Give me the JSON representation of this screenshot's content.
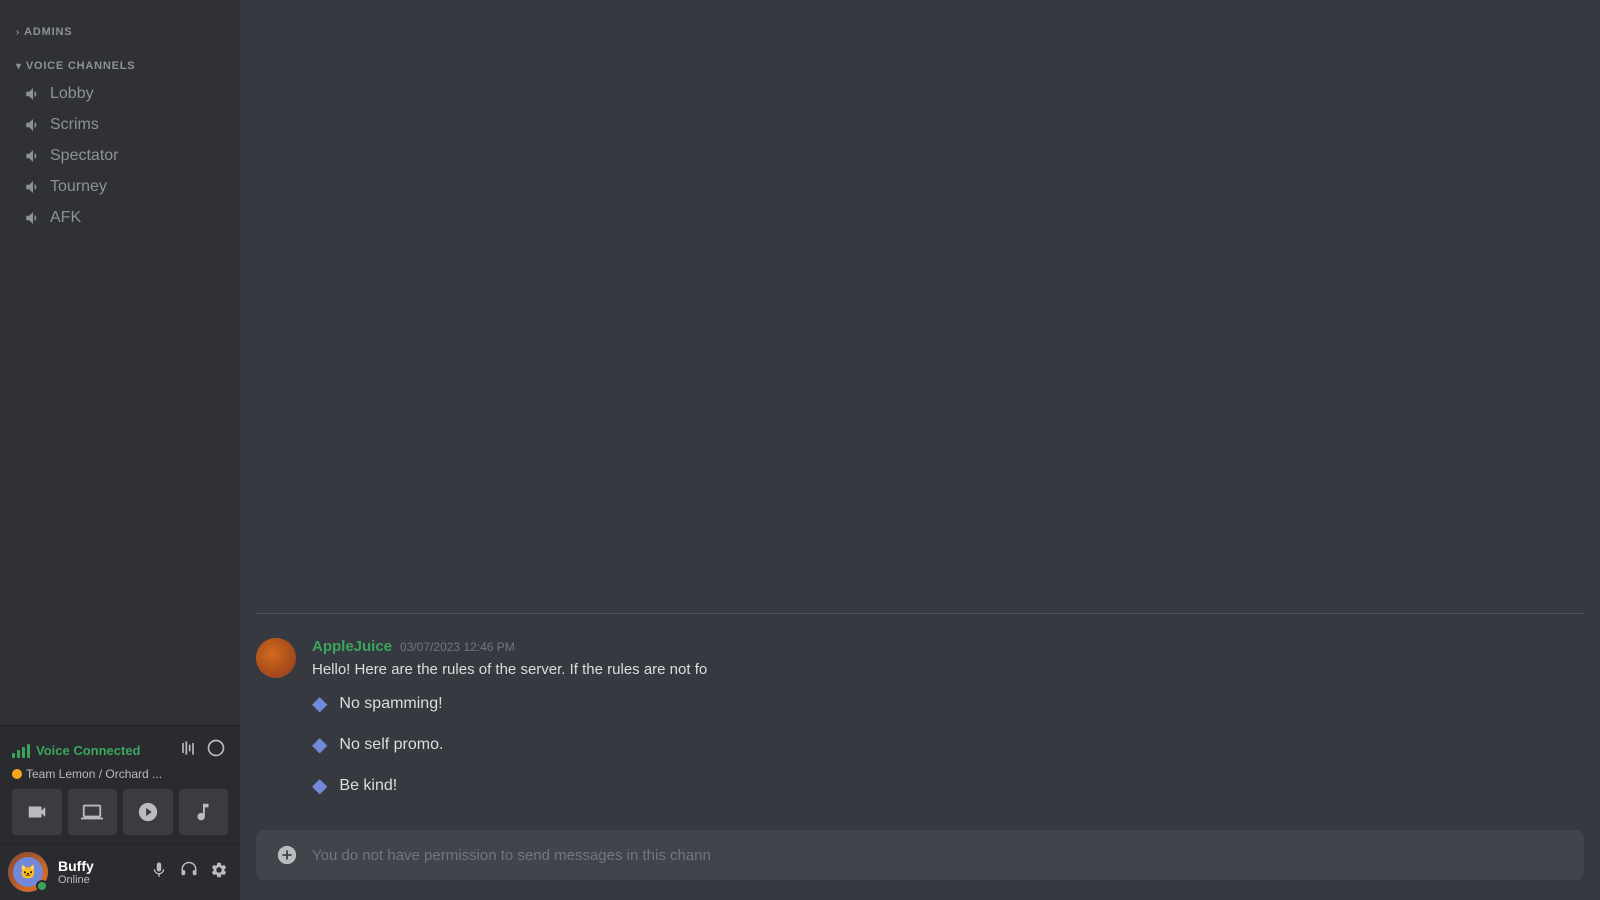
{
  "sidebar": {
    "sections": [
      {
        "id": "admins",
        "label": "ADMINS",
        "collapsed": true,
        "chevron": "›",
        "channels": []
      },
      {
        "id": "voice-channels",
        "label": "VOICE CHANNELS",
        "collapsed": false,
        "chevron": "▾",
        "channels": [
          {
            "id": "lobby",
            "name": "Lobby",
            "icon": "🔊"
          },
          {
            "id": "scrims",
            "name": "Scrims",
            "icon": "🔊"
          },
          {
            "id": "spectator",
            "name": "Spectator",
            "icon": "🔊"
          },
          {
            "id": "tourney",
            "name": "Tourney",
            "icon": "🔊"
          },
          {
            "id": "afk",
            "name": "AFK",
            "icon": "🔊"
          }
        ]
      }
    ],
    "voice_panel": {
      "title": "Voice Connected",
      "subtitle": "Team Lemon / Orchard ...",
      "subtitle_dot_color": "#faa61a"
    },
    "user": {
      "name": "Buffy",
      "status": "Online",
      "status_color": "#3ba55c"
    }
  },
  "chat": {
    "message": {
      "author": "AppleJuice",
      "author_color": "#3ba55c",
      "timestamp": "03/07/2023 12:46 PM",
      "text": "Hello! Here are the rules of the server. If the rules are not fo",
      "rules": [
        {
          "id": "rule1",
          "text": "No spamming!"
        },
        {
          "id": "rule2",
          "text": "No self promo."
        },
        {
          "id": "rule3",
          "text": "Be kind!"
        }
      ]
    },
    "input_placeholder": "You do not have permission to send messages in this chann"
  },
  "icons": {
    "volume": "🔊",
    "camera": "📷",
    "screen_share": "🖥",
    "boost": "🚀",
    "music": "🎵",
    "microphone": "🎤",
    "headset": "🎧",
    "settings": "⚙",
    "disconnect": "✖",
    "waveform": "🎙",
    "add": "➕",
    "diamond": "◆"
  }
}
